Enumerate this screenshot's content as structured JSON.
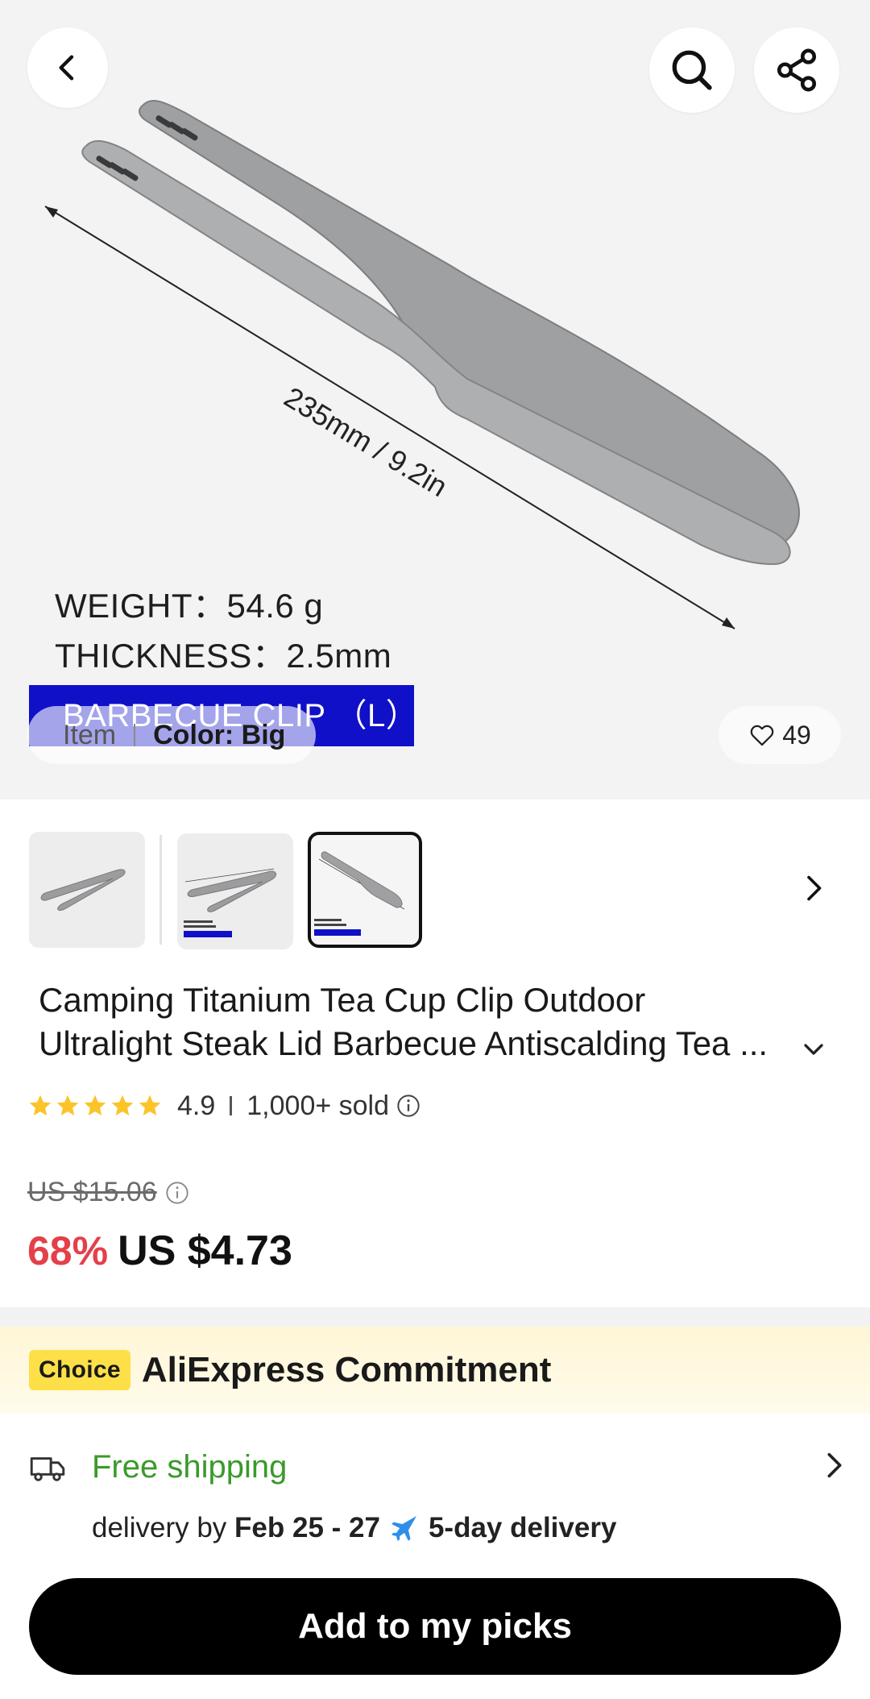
{
  "hero": {
    "dimension_label": "235mm / 9.2in",
    "weight_label": "WEIGHT：54.6 g",
    "thickness_label": "THICKNESS：2.5mm",
    "banner_label": "BARBECUE CLIP （L）",
    "item_label": "Item",
    "color_label": "Color: Big",
    "likes": "49"
  },
  "header_icons": [
    "back-icon",
    "search-icon",
    "share-icon"
  ],
  "product": {
    "title_line1": "Camping Titanium Tea Cup Clip Outdoor",
    "title_line2": "Ultralight Steak Lid Barbecue Antiscalding Tea ..."
  },
  "rating": {
    "score": "4.9",
    "stars": 5,
    "sold": "1,000+ sold"
  },
  "pricing": {
    "original": "US $15.06",
    "discount": "68%",
    "current": "US $4.73"
  },
  "commitment": {
    "badge": "Choice",
    "title": "AliExpress Commitment"
  },
  "shipping": {
    "title": "Free shipping",
    "delivery_prefix": "delivery by",
    "delivery_dates": "Feb 25 - 27",
    "delivery_speed": "5-day delivery"
  },
  "cta": {
    "label": "Add to my picks"
  },
  "colors": {
    "discount": "#e4404a",
    "shipping": "#3a9a2a",
    "choice_badge": "#fde047",
    "banner": "#1010c8"
  }
}
